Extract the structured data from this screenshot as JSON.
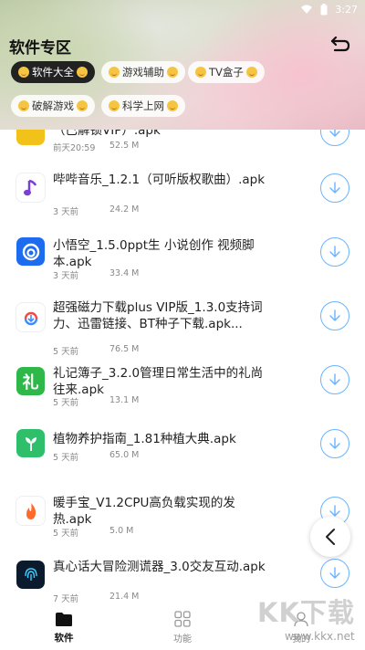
{
  "status": {
    "time": "3:27"
  },
  "header": {
    "title": "软件专区"
  },
  "chips": [
    {
      "label": "软件大全"
    },
    {
      "label": "游戏辅助"
    },
    {
      "label": "TV盒子"
    },
    {
      "label": "破解游戏"
    },
    {
      "label": "科学上网"
    }
  ],
  "list": {
    "items": [
      {
        "name": "（已解锁VIP）.apk",
        "time": "前天20:59",
        "size": "52.5 M",
        "icon": "yellow-app-icon"
      },
      {
        "name": "哔哔音乐_1.2.1（可听版权歌曲）.apk",
        "time": "3 天前",
        "size": "24.2 M",
        "icon": "music-note-icon"
      },
      {
        "name": "小悟空_1.5.0ppt生 小说创作 视频脚本.apk",
        "time": "3 天前",
        "size": "33.4 M",
        "icon": "wukong-icon"
      },
      {
        "name": "超强磁力下载plus VIP版_1.3.0支持词力、迅雷链接、BT种子下载.apk...",
        "time": "5 天前",
        "size": "76.5 M",
        "icon": "magnet-download-icon"
      },
      {
        "name": "礼记簿子_3.2.0管理日常生活中的礼尚往来.apk",
        "time": "5 天前",
        "size": "13.1 M",
        "icon": "li-character-icon"
      },
      {
        "name": "植物养护指南_1.81种植大典.apk",
        "time": "5 天前",
        "size": "65.0 M",
        "icon": "plant-icon"
      },
      {
        "name": "暖手宝_V1.2CPU高负载实现的发热.apk",
        "time": "5 天前",
        "size": "5.0 M",
        "icon": "flame-icon"
      },
      {
        "name": "真心话大冒险测谎器_3.0交友互动.apk",
        "time": "7 天前",
        "size": "21.4 M",
        "icon": "fingerprint-icon"
      }
    ]
  },
  "bottom_nav": {
    "tabs": [
      {
        "label": "软件",
        "icon": "folder-icon"
      },
      {
        "label": "功能",
        "icon": "grid-icon"
      },
      {
        "label": "我的",
        "icon": "user-icon"
      }
    ]
  },
  "watermark": {
    "big": "KK下载",
    "small": "www.kkx.net"
  },
  "colors": {
    "accent": "#69b4ff",
    "active_chip": "#222222"
  }
}
